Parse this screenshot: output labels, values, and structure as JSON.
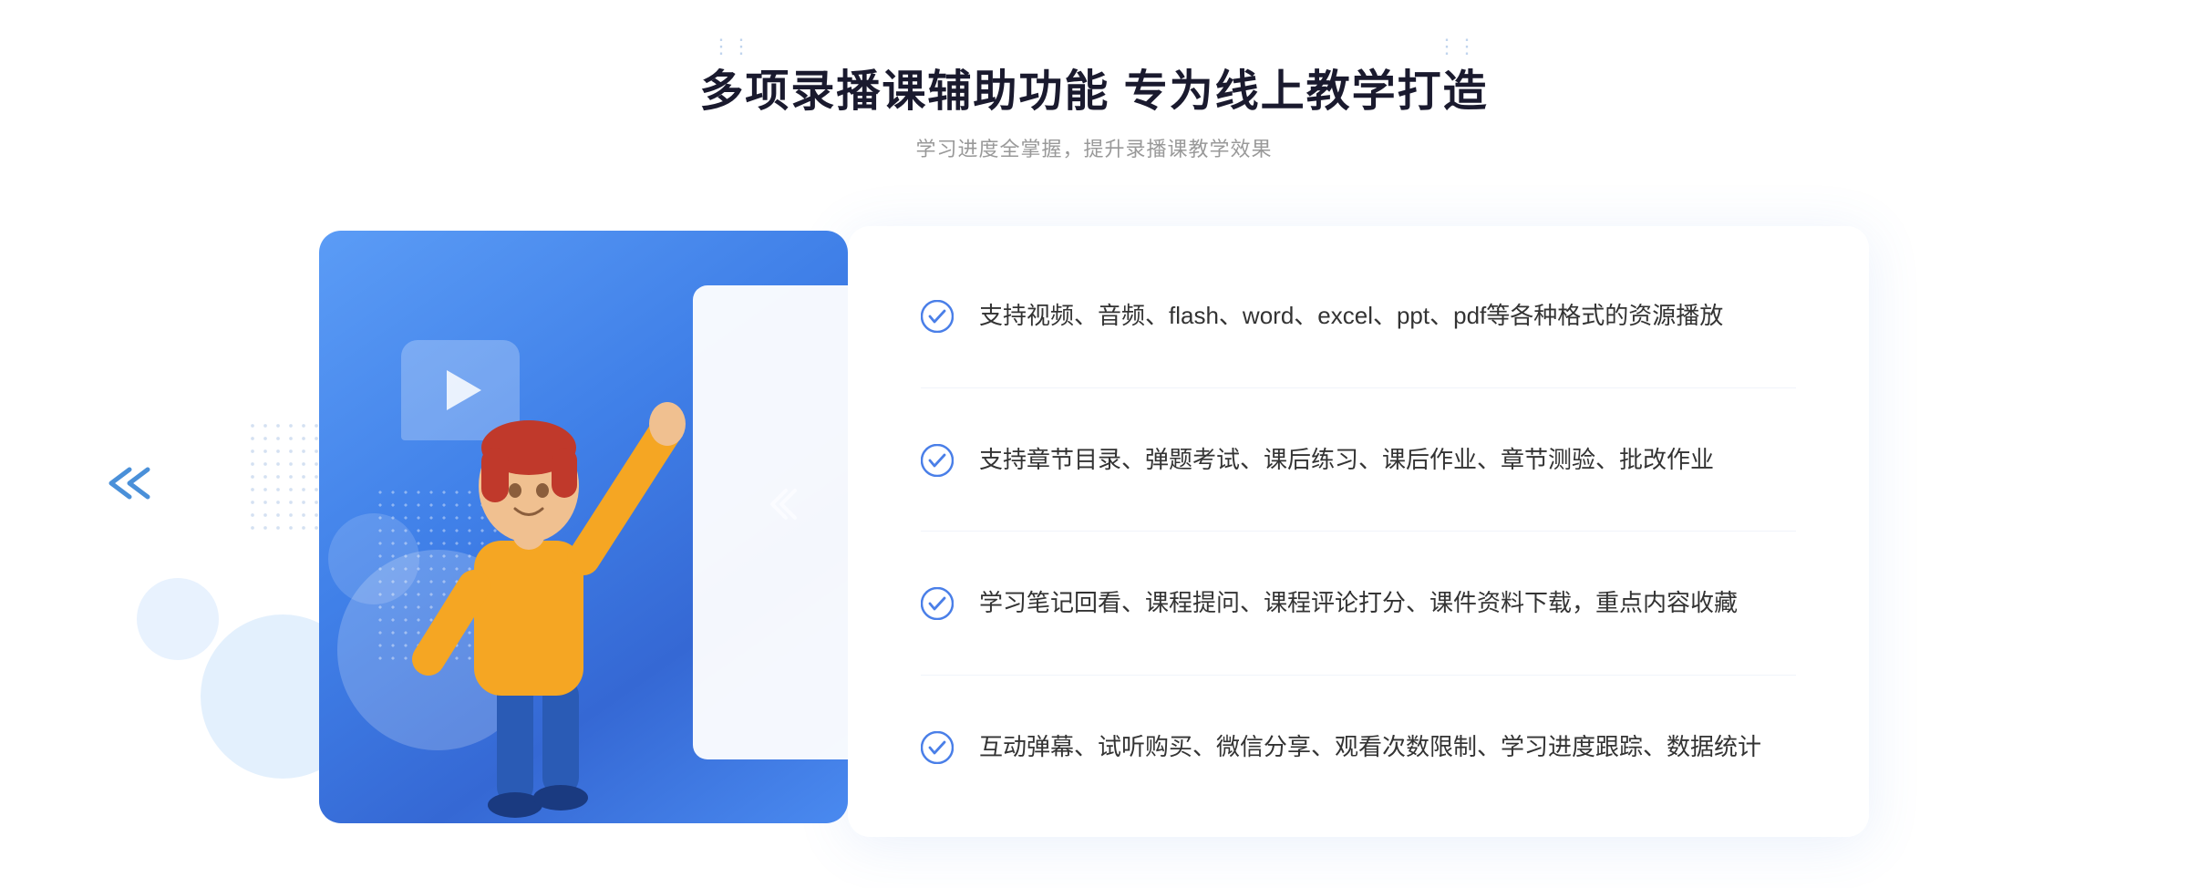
{
  "page": {
    "background": "#ffffff"
  },
  "header": {
    "main_title": "多项录播课辅助功能 专为线上教学打造",
    "sub_title": "学习进度全掌握，提升录播课教学效果",
    "decoration_dots": "···",
    "chevron_left": "⁞⁞",
    "chevron_right": "⁞⁞"
  },
  "features": [
    {
      "id": 1,
      "text": "支持视频、音频、flash、word、excel、ppt、pdf等各种格式的资源播放"
    },
    {
      "id": 2,
      "text": "支持章节目录、弹题考试、课后练习、课后作业、章节测验、批改作业"
    },
    {
      "id": 3,
      "text": "学习笔记回看、课程提问、课程评论打分、课件资料下载，重点内容收藏"
    },
    {
      "id": 4,
      "text": "互动弹幕、试听购买、微信分享、观看次数限制、学习进度跟踪、数据统计"
    }
  ],
  "icons": {
    "check": "check-circle",
    "play": "play",
    "chevron": "chevron"
  },
  "colors": {
    "primary_blue": "#4a7fe8",
    "light_blue": "#6aaef5",
    "text_dark": "#333333",
    "text_gray": "#999999",
    "title_dark": "#1a1a2e",
    "accent_blue": "#4080e8"
  }
}
